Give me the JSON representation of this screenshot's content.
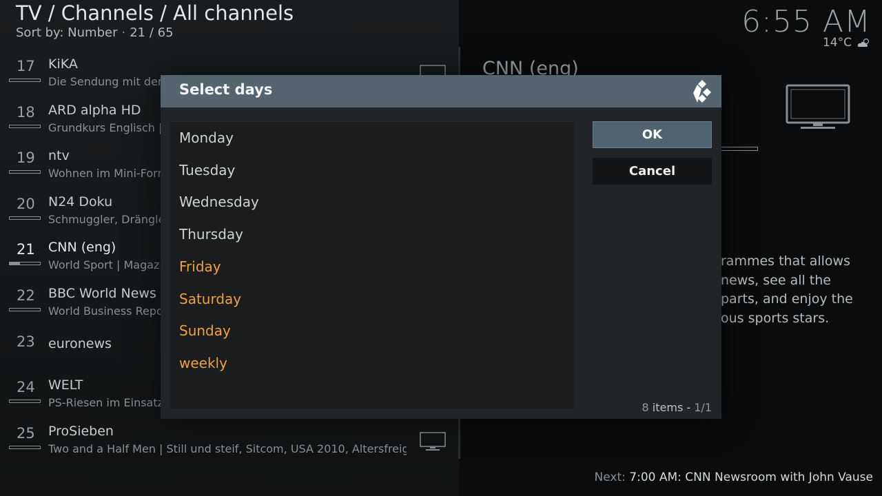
{
  "header": {
    "breadcrumb": "TV / Channels / All channels",
    "sort_label": "Sort by: Number",
    "position": "21 / 65"
  },
  "status": {
    "time": "6:55 AM",
    "temperature": "14°C",
    "weather_icon": "partly-cloudy-icon"
  },
  "channels": [
    {
      "number": "17",
      "name": "KiKA",
      "program": "Die Sendung mit dem Elefant...",
      "progress": 0,
      "has_tv_icon": true
    },
    {
      "number": "18",
      "name": "ARD alpha HD",
      "program": "Grundkurs Englisch |",
      "progress": 0,
      "has_tv_icon": false
    },
    {
      "number": "19",
      "name": "ntv",
      "program": "Wohnen im Mini-Format",
      "progress": 0,
      "has_tv_icon": false
    },
    {
      "number": "20",
      "name": "N24 Doku",
      "program": "Schmuggler, Drängler",
      "progress": 0,
      "has_tv_icon": false
    },
    {
      "number": "21",
      "name": "CNN (eng)",
      "program": "World Sport | Magazin",
      "progress": 0.35,
      "has_tv_icon": false
    },
    {
      "number": "22",
      "name": "BBC World News (eng)",
      "program": "World Business Report",
      "progress": 0,
      "has_tv_icon": false
    },
    {
      "number": "23",
      "name": "euronews",
      "program": "",
      "progress": 0,
      "has_tv_icon": false
    },
    {
      "number": "24",
      "name": "WELT",
      "program": "PS-Riesen im Einsatz",
      "progress": 0,
      "has_tv_icon": false
    },
    {
      "number": "25",
      "name": "ProSieben",
      "program": "Two and a Half Men | Still und steif, Sitcom, USA 2010, Altersfreig...",
      "progress": 0,
      "has_tv_icon": true
    }
  ],
  "info_panel": {
    "channel_title": "CNN (eng)",
    "description_lines": [
      "rammes that allows",
      "news, see all the",
      "parts, and enjoy the",
      "ous sports stars."
    ]
  },
  "next_program": {
    "label": "Next:",
    "value": "7:00 AM: CNN Newsroom with John Vause"
  },
  "dialog": {
    "title": "Select days",
    "items": [
      {
        "label": "Monday",
        "selected": false
      },
      {
        "label": "Tuesday",
        "selected": false
      },
      {
        "label": "Wednesday",
        "selected": false
      },
      {
        "label": "Thursday",
        "selected": false
      },
      {
        "label": "Friday",
        "selected": true
      },
      {
        "label": "Saturday",
        "selected": true
      },
      {
        "label": "Sunday",
        "selected": true
      },
      {
        "label": "weekly",
        "selected": true
      }
    ],
    "ok_label": "OK",
    "cancel_label": "Cancel",
    "items_count": "8",
    "items_word": "items",
    "pages": "1/1"
  },
  "colors": {
    "selected": "#f0a23a",
    "dialog_header": "#54656f",
    "focused_button": "#4f6370"
  }
}
